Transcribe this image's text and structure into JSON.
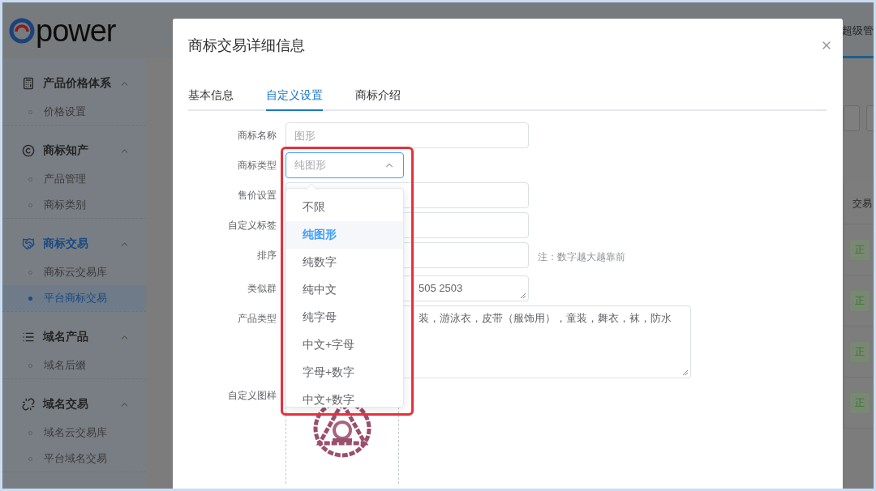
{
  "header": {
    "logo_text": "power",
    "user": "超级管"
  },
  "sidebar": {
    "groups": [
      {
        "title": "产品价格体系",
        "expanded": true,
        "active": false,
        "items": [
          {
            "label": "价格设置",
            "selected": false
          }
        ]
      },
      {
        "title": "商标知产",
        "expanded": true,
        "active": false,
        "items": [
          {
            "label": "产品管理",
            "selected": false
          },
          {
            "label": "商标类别",
            "selected": false
          }
        ]
      },
      {
        "title": "商标交易",
        "expanded": true,
        "active": true,
        "items": [
          {
            "label": "商标云交易库",
            "selected": false
          },
          {
            "label": "平台商标交易",
            "selected": true
          }
        ]
      },
      {
        "title": "域名产品",
        "expanded": true,
        "active": false,
        "items": [
          {
            "label": "域名后缀",
            "selected": false
          }
        ]
      },
      {
        "title": "域名交易",
        "expanded": true,
        "active": false,
        "items": [
          {
            "label": "域名云交易库",
            "selected": false
          },
          {
            "label": "平台域名交易",
            "selected": false
          }
        ]
      }
    ]
  },
  "background_table": {
    "column_header": "交易",
    "tags": [
      "正",
      "正",
      "正",
      "正"
    ]
  },
  "dialog": {
    "title": "商标交易详细信息",
    "tabs": [
      {
        "label": "基本信息",
        "selected": false
      },
      {
        "label": "自定义设置",
        "selected": true
      },
      {
        "label": "商标介绍",
        "selected": false
      }
    ],
    "fields": [
      {
        "kind": "input",
        "label": "商标名称",
        "placeholder": "图形"
      },
      {
        "kind": "select",
        "label": "商标类型",
        "placeholder": "纯图形",
        "open": true
      },
      {
        "kind": "input",
        "label": "售价设置"
      },
      {
        "kind": "input",
        "label": "自定义标签"
      },
      {
        "kind": "input",
        "label": "排序",
        "note": "注：数字越大越靠前"
      },
      {
        "kind": "line-textarea",
        "label": "类似群",
        "value": "505 2503"
      },
      {
        "kind": "textarea",
        "label": "产品类型",
        "value": "装，游泳衣，皮带（服饰用），童装，舞衣，袜，防水"
      },
      {
        "kind": "upload",
        "label": "自定义图样"
      }
    ],
    "dropdown": {
      "highlighted": true,
      "options": [
        {
          "label": "不限",
          "selected": false
        },
        {
          "label": "纯图形",
          "selected": true
        },
        {
          "label": "纯数字",
          "selected": false
        },
        {
          "label": "纯中文",
          "selected": false
        },
        {
          "label": "纯字母",
          "selected": false
        },
        {
          "label": "中文+字母",
          "selected": false
        },
        {
          "label": "字母+数字",
          "selected": false
        },
        {
          "label": "中文+数字",
          "selected": false
        }
      ]
    }
  }
}
